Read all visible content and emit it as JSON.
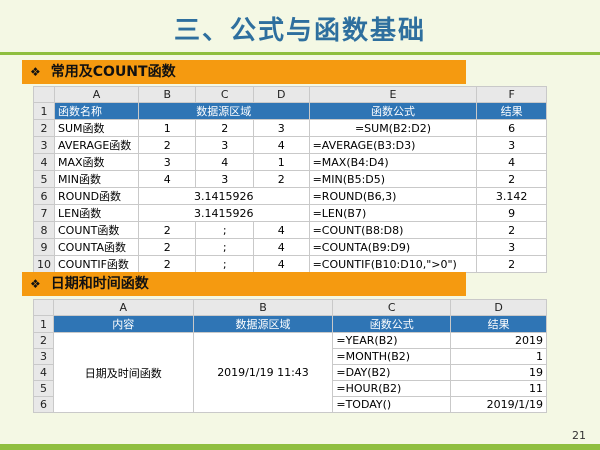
{
  "slide": {
    "title": "三、公式与函数基础",
    "page_number": "21"
  },
  "section1": {
    "header": "常用及COUNT函数",
    "columns": [
      "A",
      "B",
      "C",
      "D",
      "E",
      "F"
    ],
    "rows": [
      {
        "n": "1",
        "a": "函数名称",
        "source": "数据源区域",
        "e": "函数公式",
        "f": "结果"
      },
      {
        "n": "2",
        "a": "SUM函数",
        "b": "1",
        "c": "2",
        "d": "3",
        "e": "=SUM(B2:D2)",
        "f": "6"
      },
      {
        "n": "3",
        "a": "AVERAGE函数",
        "b": "2",
        "c": "3",
        "d": "4",
        "e": "=AVERAGE(B3:D3)",
        "f": "3"
      },
      {
        "n": "4",
        "a": "MAX函数",
        "b": "3",
        "c": "4",
        "d": "1",
        "e": "=MAX(B4:D4)",
        "f": "4"
      },
      {
        "n": "5",
        "a": "MIN函数",
        "b": "4",
        "c": "3",
        "d": "2",
        "e": "=MIN(B5:D5)",
        "f": "2"
      },
      {
        "n": "6",
        "a": "ROUND函数",
        "c": "3.1415926",
        "e": "=ROUND(B6,3)",
        "f": "3.142"
      },
      {
        "n": "7",
        "a": "LEN函数",
        "c": "3.1415926",
        "e": "=LEN(B7)",
        "f": "9"
      },
      {
        "n": "8",
        "a": "COUNT函数",
        "b": "2",
        "c": ";",
        "d": "4",
        "e": "=COUNT(B8:D8)",
        "f": "2"
      },
      {
        "n": "9",
        "a": "COUNTA函数",
        "b": "2",
        "c": ";",
        "d": "4",
        "e": "=COUNTA(B9:D9)",
        "f": "3"
      },
      {
        "n": "10",
        "a": "COUNTIF函数",
        "b": "2",
        "c": ";",
        "d": "4",
        "e": "=COUNTIF(B10:D10,\">0\")",
        "f": "2"
      }
    ]
  },
  "section2": {
    "header": "日期和时间函数",
    "columns": [
      "A",
      "B",
      "C",
      "D"
    ],
    "header_row": {
      "n": "1",
      "a": "内容",
      "b": "数据源区域",
      "c": "函数公式",
      "d": "结果"
    },
    "merged_content": "日期及时间函数",
    "merged_source": "2019/1/19 11:43",
    "rows": [
      {
        "n": "2",
        "c": "=YEAR(B2)",
        "d": "2019"
      },
      {
        "n": "3",
        "c": "=MONTH(B2)",
        "d": "1"
      },
      {
        "n": "4",
        "c": "=DAY(B2)",
        "d": "19"
      },
      {
        "n": "5",
        "c": "=HOUR(B2)",
        "d": "11"
      },
      {
        "n": "6",
        "c": "=TODAY()",
        "d": "2019/1/19"
      }
    ]
  },
  "chart_data": {
    "type": "table",
    "tables": [
      {
        "name": "常用及COUNT函数",
        "columns": [
          "函数名称",
          "数据源区域",
          "函数公式",
          "结果"
        ],
        "rows": [
          [
            "SUM函数",
            "1 2 3",
            "=SUM(B2:D2)",
            "6"
          ],
          [
            "AVERAGE函数",
            "2 3 4",
            "=AVERAGE(B3:D3)",
            "3"
          ],
          [
            "MAX函数",
            "3 4 1",
            "=MAX(B4:D4)",
            "4"
          ],
          [
            "MIN函数",
            "4 3 2",
            "=MIN(B5:D5)",
            "2"
          ],
          [
            "ROUND函数",
            "3.1415926",
            "=ROUND(B6,3)",
            "3.142"
          ],
          [
            "LEN函数",
            "3.1415926",
            "=LEN(B7)",
            "9"
          ],
          [
            "COUNT函数",
            "2 ; 4",
            "=COUNT(B8:D8)",
            "2"
          ],
          [
            "COUNTA函数",
            "2 ; 4",
            "=COUNTA(B9:D9)",
            "3"
          ],
          [
            "COUNTIF函数",
            "2 ; 4",
            "=COUNTIF(B10:D10,\">0\")",
            "2"
          ]
        ]
      },
      {
        "name": "日期和时间函数",
        "columns": [
          "内容",
          "数据源区域",
          "函数公式",
          "结果"
        ],
        "rows": [
          [
            "日期及时间函数",
            "2019/1/19 11:43",
            "=YEAR(B2)",
            "2019"
          ],
          [
            "日期及时间函数",
            "2019/1/19 11:43",
            "=MONTH(B2)",
            "1"
          ],
          [
            "日期及时间函数",
            "2019/1/19 11:43",
            "=DAY(B2)",
            "19"
          ],
          [
            "日期及时间函数",
            "2019/1/19 11:43",
            "=HOUR(B2)",
            "11"
          ],
          [
            "日期及时间函数",
            "2019/1/19 11:43",
            "=TODAY()",
            "2019/1/19"
          ]
        ]
      }
    ]
  },
  "colors": {
    "header_fill": "#2f75b5",
    "section_bar": "#f59a10",
    "accent_green": "#8fbf3f",
    "title_color": "#2e6f9e"
  }
}
